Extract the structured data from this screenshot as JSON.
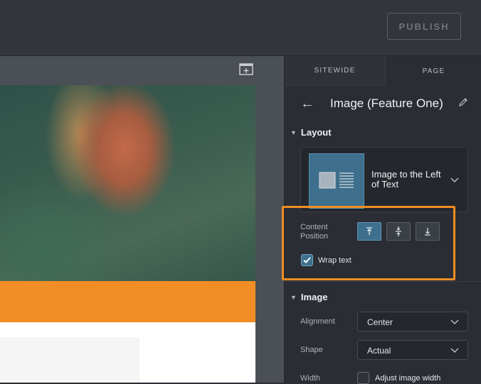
{
  "topbar": {
    "publish_label": "PUBLISH"
  },
  "canvas": {
    "add_icon": "add-section-icon"
  },
  "panel": {
    "tabs": [
      {
        "label": "SITEWIDE",
        "active": false
      },
      {
        "label": "PAGE",
        "active": true
      }
    ],
    "title": "Image (Feature One)",
    "layout": {
      "section_title": "Layout",
      "selected_layout": "Image to the Left of Text",
      "content_position_label": "Content Position",
      "content_position_selected": "top",
      "wrap_text_label": "Wrap text",
      "wrap_text_checked": true
    },
    "image": {
      "section_title": "Image",
      "alignment_label": "Alignment",
      "alignment_value": "Center",
      "shape_label": "Shape",
      "shape_value": "Actual",
      "width_label": "Width",
      "adjust_width_label": "Adjust image width",
      "adjust_width_checked": false
    }
  },
  "colors": {
    "accent_highlight": "#f08d24",
    "active_blue": "#3e6f8c",
    "orange_band": "#f08d24"
  }
}
